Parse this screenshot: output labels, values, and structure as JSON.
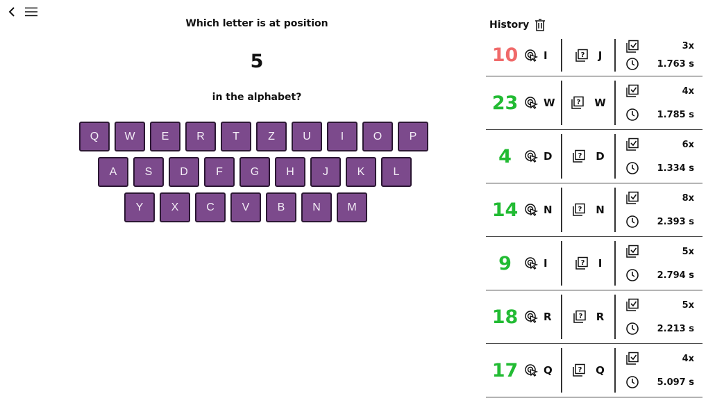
{
  "question": {
    "line1": "Which letter is at position",
    "number": "5",
    "line2": "in the alphabet?"
  },
  "keyboard": {
    "row1": [
      "Q",
      "W",
      "E",
      "R",
      "T",
      "Z",
      "U",
      "I",
      "O",
      "P"
    ],
    "row2": [
      "A",
      "S",
      "D",
      "F",
      "G",
      "H",
      "J",
      "K",
      "L"
    ],
    "row3": [
      "Y",
      "X",
      "C",
      "V",
      "B",
      "N",
      "M"
    ]
  },
  "history": {
    "title": "History",
    "rows": [
      {
        "number": "10",
        "picked": "I",
        "answer": "J",
        "attempts": "3x",
        "time": "1.763 s",
        "correct": false
      },
      {
        "number": "23",
        "picked": "W",
        "answer": "W",
        "attempts": "4x",
        "time": "1.785 s",
        "correct": true
      },
      {
        "number": "4",
        "picked": "D",
        "answer": "D",
        "attempts": "6x",
        "time": "1.334 s",
        "correct": true
      },
      {
        "number": "14",
        "picked": "N",
        "answer": "N",
        "attempts": "8x",
        "time": "2.393 s",
        "correct": true
      },
      {
        "number": "9",
        "picked": "I",
        "answer": "I",
        "attempts": "5x",
        "time": "2.794 s",
        "correct": true
      },
      {
        "number": "18",
        "picked": "R",
        "answer": "R",
        "attempts": "5x",
        "time": "2.213 s",
        "correct": true
      },
      {
        "number": "17",
        "picked": "Q",
        "answer": "Q",
        "attempts": "4x",
        "time": "5.097 s",
        "correct": true
      }
    ]
  },
  "colors": {
    "key": "#7c4a8c",
    "correct": "#22bb33",
    "wrong": "#f06a6a"
  }
}
